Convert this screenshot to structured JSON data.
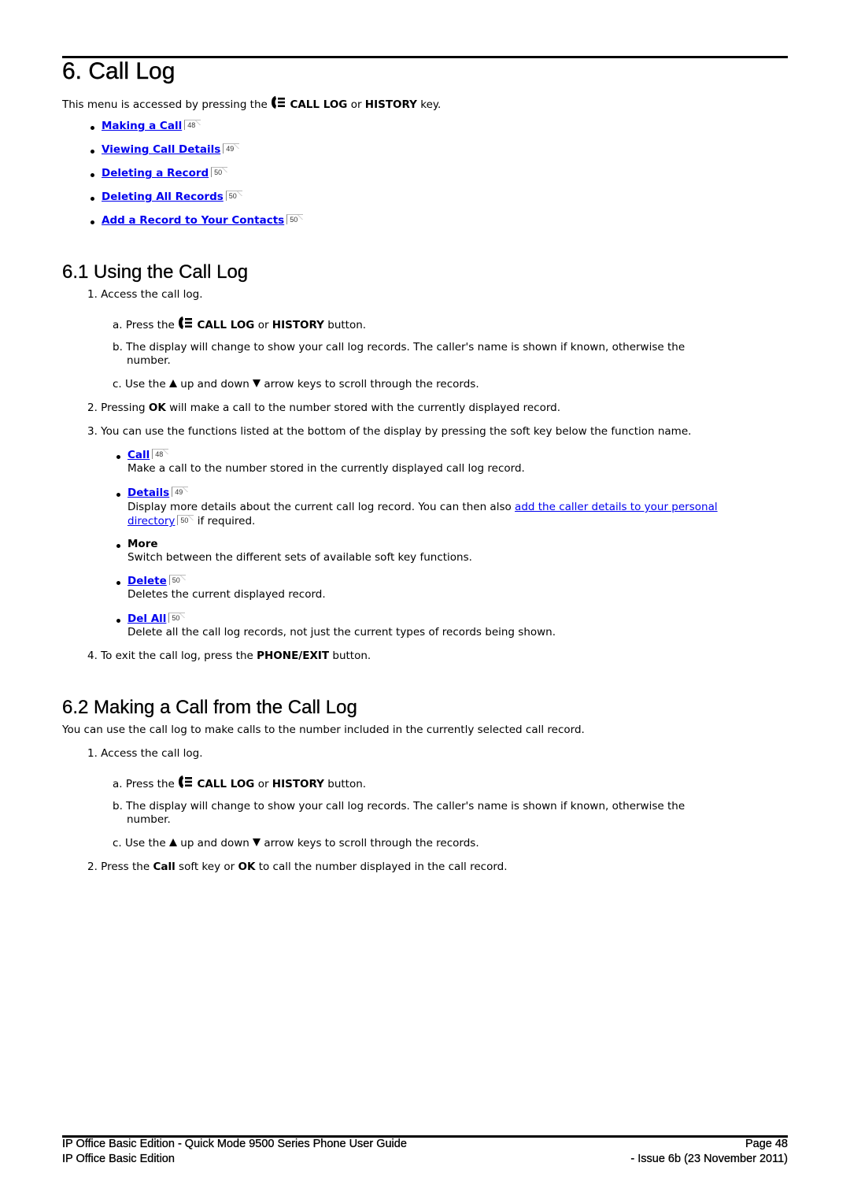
{
  "chapter": {
    "title": "6. Call Log",
    "intro_prefix": "This menu is accessed by pressing the",
    "intro_key1": "CALL LOG",
    "intro_or": "or",
    "intro_key2": "HISTORY",
    "intro_suffix": "key.",
    "toc": [
      {
        "label": "Making a Call",
        "page": "48"
      },
      {
        "label": "Viewing Call Details",
        "page": "49"
      },
      {
        "label": "Deleting a Record",
        "page": "50"
      },
      {
        "label": "Deleting All Records",
        "page": "50"
      },
      {
        "label": "Add a Record to Your Contacts",
        "page": "50"
      }
    ]
  },
  "section1": {
    "title": "6.1 Using the Call Log",
    "step1": "1. Access the call log.",
    "step1a_prefix": "a. Press the",
    "step1a_key1": "CALL LOG",
    "step1a_or": "or",
    "step1a_key2": "HISTORY",
    "step1a_suffix": "button.",
    "step1b_line1": "b. The display will change to show your call log records. The caller's name is shown if known, otherwise the",
    "step1b_line2": "number.",
    "step1c_prefix": "c. Use the",
    "step1c_mid": "up and down",
    "step1c_suffix": "arrow keys to scroll through the records.",
    "step2_prefix": "2. Pressing",
    "step2_bold": "OK",
    "step2_suffix": "will make a call to the number stored with the currently displayed record.",
    "step3": "3. You can use the functions listed at the bottom of the display by pressing the soft key below the function name.",
    "functions": [
      {
        "label": "Call",
        "page": "48",
        "desc": "Make a call to the number stored in the currently displayed call log record."
      },
      {
        "label": "Details",
        "page": "49",
        "desc_prefix": "Display more details about the current call log record. You can then also",
        "desc_link1": "add the caller details to your personal",
        "desc_link2": "directory",
        "desc_link_page": "50",
        "desc_suffix": "if required."
      },
      {
        "label": "More",
        "desc": "Switch between the different sets of available soft key functions."
      },
      {
        "label": "Delete",
        "page": "50",
        "desc": "Deletes the current displayed record."
      },
      {
        "label": "Del All",
        "page": "50",
        "desc": "Delete all the call log records, not just the current types of records being shown."
      }
    ],
    "step4_prefix": "4. To exit the call log, press the",
    "step4_bold": "PHONE/EXIT",
    "step4_suffix": "button."
  },
  "section2": {
    "title": "6.2 Making a Call from the Call Log",
    "intro": "You can use the call log to make calls to the number included in the currently selected call record.",
    "step1": "1. Access the call log.",
    "step1a_prefix": "a. Press the",
    "step1a_key1": "CALL LOG",
    "step1a_or": "or",
    "step1a_key2": "HISTORY",
    "step1a_suffix": "button.",
    "step1b_line1": "b. The display will change to show your call log records. The caller's name is shown if known, otherwise the",
    "step1b_line2": "number.",
    "step1c_prefix": "c. Use the",
    "step1c_mid": "up and down",
    "step1c_suffix": "arrow keys to scroll through the records.",
    "step2_prefix": "2. Press the",
    "step2_bold1": "Call",
    "step2_mid": "soft key or",
    "step2_bold2": "OK",
    "step2_suffix": "to call the number displayed in the call record."
  },
  "footer": {
    "left_line1": "IP Office Basic Edition - Quick Mode 9500 Series Phone User Guide",
    "left_line2": "IP Office Basic Edition",
    "right_line1": "Page 48",
    "right_line2": "- Issue 6b (23 November 2011)"
  }
}
